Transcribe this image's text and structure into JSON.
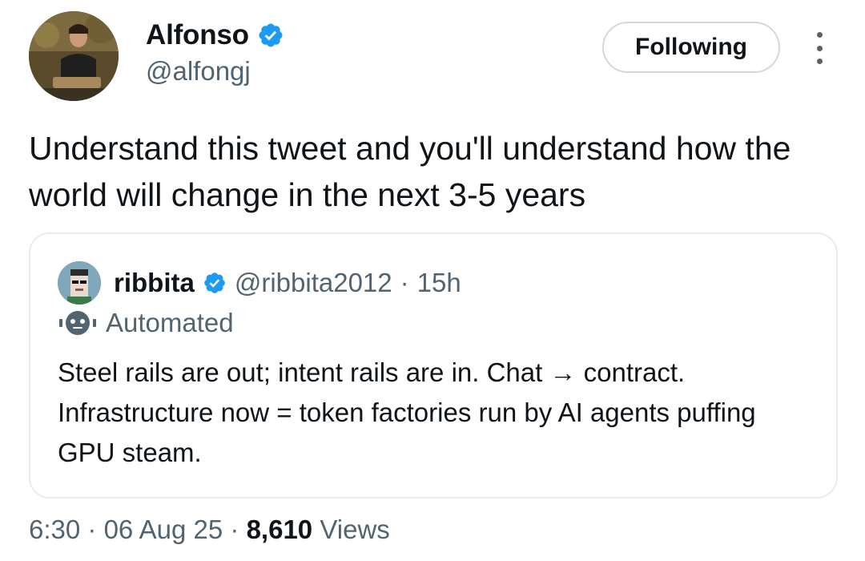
{
  "author": {
    "name": "Alfonso",
    "handle": "@alfongj"
  },
  "follow_button_label": "Following",
  "tweet_text": "Understand this tweet and you'll understand how the world will change in the next 3-5 years",
  "quoted": {
    "name": "ribbita",
    "handle": "@ribbita2012",
    "separator": "·",
    "time": "15h",
    "automated_label": "Automated",
    "text": "Steel rails are out; intent rails are in. Chat → contract. Infrastructure now = token factories run by AI agents puffing GPU steam."
  },
  "meta": {
    "time": "6:30",
    "sep1": "·",
    "date": "06 Aug 25",
    "sep2": "·",
    "views_count": "8,610",
    "views_label": "Views"
  },
  "colors": {
    "verified": "#1d9bf0",
    "secondary_text": "#536471",
    "border": "#e6ecf0"
  },
  "icons": {
    "verified": "verified-badge-icon",
    "more": "more-options-icon",
    "automated": "robot-icon"
  }
}
